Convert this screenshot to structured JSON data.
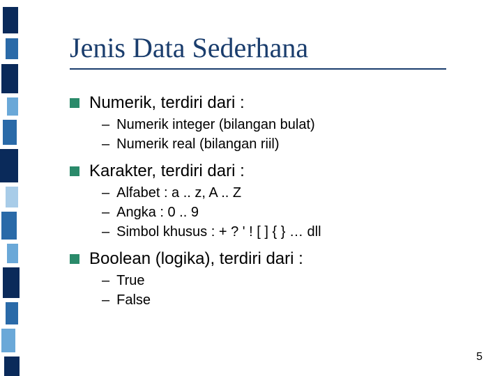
{
  "title": "Jenis Data Sederhana",
  "bullets": [
    {
      "label": "Numerik, terdiri dari :",
      "subs": [
        "Numerik integer (bilangan bulat)",
        "Numerik real (bilangan riil)"
      ]
    },
    {
      "label": "Karakter, terdiri dari :",
      "subs": [
        "Alfabet : a .. z, A .. Z",
        "Angka : 0 .. 9",
        "Simbol khusus : + ? ' ! [ ] { } … dll"
      ]
    },
    {
      "label": "Boolean (logika), terdiri dari :",
      "subs": [
        "True",
        "False"
      ]
    }
  ],
  "page_number": "5",
  "decoration_colors": {
    "dark": "#0a2a5a",
    "mid": "#2a6aa8",
    "light": "#6aa8d8",
    "pale": "#a8cce8"
  }
}
